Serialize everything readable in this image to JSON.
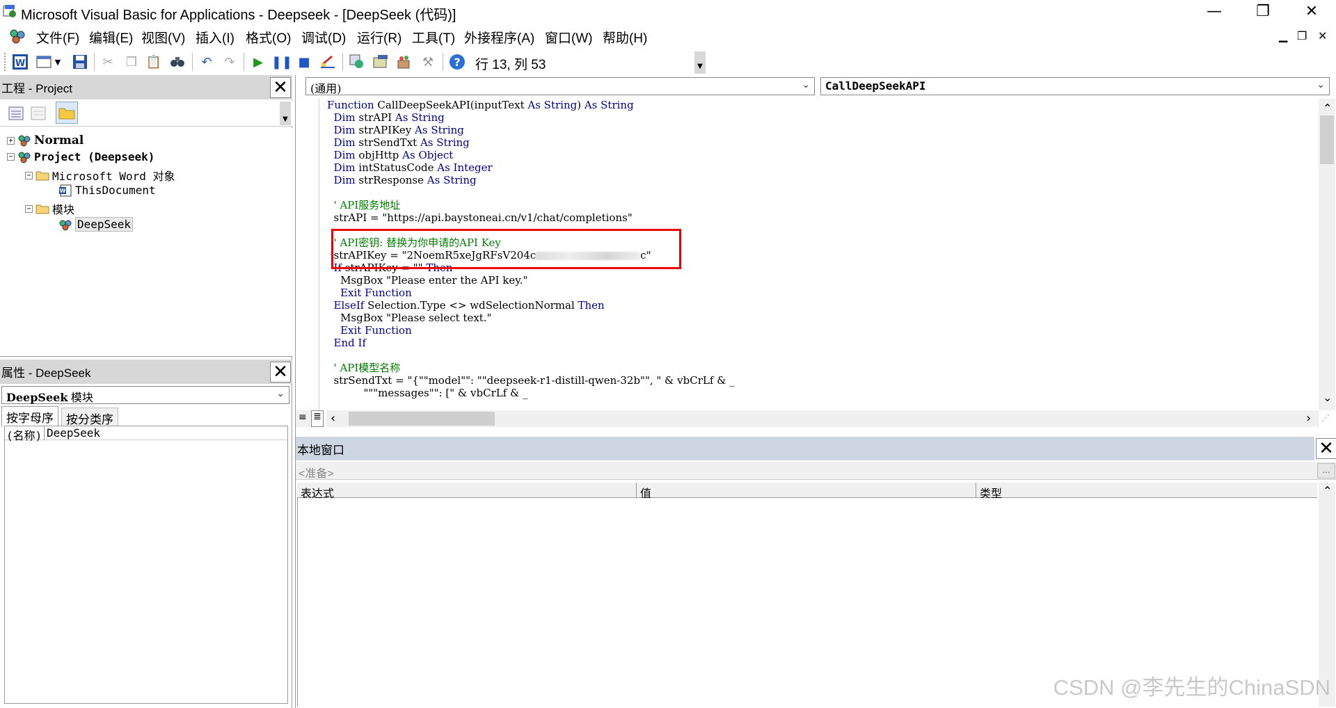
{
  "window": {
    "title": "Microsoft Visual Basic for Applications - Deepseek - [DeepSeek (代码)]",
    "minimize": "—",
    "restore": "❐",
    "close": "✕"
  },
  "menu": {
    "items": [
      "文件(F)",
      "编辑(E)",
      "视图(V)",
      "插入(I)",
      "格式(O)",
      "调试(D)",
      "运行(R)",
      "工具(T)",
      "外接程序(A)",
      "窗口(W)",
      "帮助(H)"
    ],
    "mdi_minimize": "▁",
    "mdi_restore": "❐",
    "mdi_close": "✕"
  },
  "toolbar": {
    "cursor_position": "行 13, 列 53"
  },
  "project_pane": {
    "title": "工程 - Project",
    "close": "✕",
    "tree": {
      "normal": "Normal",
      "project": "Project (Deepseek)",
      "word_objects": "Microsoft Word 对象",
      "this_document": "ThisDocument",
      "modules": "模块",
      "deepseek": "DeepSeek"
    }
  },
  "properties_pane": {
    "title": "属性 - DeepSeek",
    "close": "✕",
    "object_bold": "DeepSeek",
    "object_type": " 模块",
    "tabs": [
      "按字母序",
      "按分类序"
    ],
    "row_name": "(名称)",
    "row_value": "DeepSeek"
  },
  "code_window": {
    "object_combo": "(通用)",
    "procedure_combo": "CallDeepSeekAPI",
    "lines": [
      [
        [
          "kw",
          "Function "
        ],
        [
          "t",
          "CallDeepSeekAPI(inputText "
        ],
        [
          "kw",
          "As String"
        ],
        [
          "t",
          ") "
        ],
        [
          "kw",
          "As String"
        ]
      ],
      [
        [
          "t",
          "  "
        ],
        [
          "kw",
          "Dim "
        ],
        [
          "t",
          "strAPI "
        ],
        [
          "kw",
          "As String"
        ]
      ],
      [
        [
          "t",
          "  "
        ],
        [
          "kw",
          "Dim "
        ],
        [
          "t",
          "strAPIKey "
        ],
        [
          "kw",
          "As String"
        ]
      ],
      [
        [
          "t",
          "  "
        ],
        [
          "kw",
          "Dim "
        ],
        [
          "t",
          "strSendTxt "
        ],
        [
          "kw",
          "As String"
        ]
      ],
      [
        [
          "t",
          "  "
        ],
        [
          "kw",
          "Dim "
        ],
        [
          "t",
          "objHttp "
        ],
        [
          "kw",
          "As Object"
        ]
      ],
      [
        [
          "t",
          "  "
        ],
        [
          "kw",
          "Dim "
        ],
        [
          "t",
          "intStatusCode "
        ],
        [
          "kw",
          "As Integer"
        ]
      ],
      [
        [
          "t",
          "  "
        ],
        [
          "kw",
          "Dim "
        ],
        [
          "t",
          "strResponse "
        ],
        [
          "kw",
          "As String"
        ]
      ],
      [
        [
          "t",
          ""
        ]
      ],
      [
        [
          "t",
          "  "
        ],
        [
          "cm",
          "' API服务地址"
        ]
      ],
      [
        [
          "t",
          "  strAPI = \"https://api.baystoneai.cn/v1/chat/completions\""
        ]
      ],
      [
        [
          "t",
          ""
        ]
      ],
      [
        [
          "t",
          "  "
        ],
        [
          "cm",
          "' API密钥: 替换为你申请的API Key"
        ]
      ],
      [
        [
          "t",
          "  strAPIKey = \"2NoemR5xeJgRFsV204c"
        ],
        [
          "blur",
          ""
        ],
        [
          "t",
          "c\""
        ]
      ],
      [
        [
          "t",
          "  "
        ],
        [
          "kw",
          "If "
        ],
        [
          "t",
          "strAPIKey = \"\" "
        ],
        [
          "kw",
          "Then"
        ]
      ],
      [
        [
          "t",
          "    MsgBox \"Please enter the API key.\""
        ]
      ],
      [
        [
          "t",
          "    "
        ],
        [
          "kw",
          "Exit Function"
        ]
      ],
      [
        [
          "t",
          "  "
        ],
        [
          "kw",
          "ElseIf "
        ],
        [
          "t",
          "Selection.Type <> wdSelectionNormal "
        ],
        [
          "kw",
          "Then"
        ]
      ],
      [
        [
          "t",
          "    MsgBox \"Please select text.\""
        ]
      ],
      [
        [
          "t",
          "    "
        ],
        [
          "kw",
          "Exit Function"
        ]
      ],
      [
        [
          "t",
          "  "
        ],
        [
          "kw",
          "End If"
        ]
      ],
      [
        [
          "t",
          ""
        ]
      ],
      [
        [
          "t",
          "  "
        ],
        [
          "cm",
          "' API模型名称"
        ]
      ],
      [
        [
          "t",
          "  strSendTxt = \"{\"\"model\"\": \"\"deepseek-r1-distill-qwen-32b\"\", \" & vbCrLf & _"
        ]
      ],
      [
        [
          "t",
          "           \"\"\"messages\"\": [\" & vbCrLf & _"
        ]
      ]
    ]
  },
  "locals_window": {
    "title": "本地窗口",
    "close": "✕",
    "status": "<准备>",
    "ellipsis": "...",
    "columns": [
      "表达式",
      "值",
      "类型"
    ]
  },
  "watermark": "CSDN @李先生的ChinaSDN"
}
